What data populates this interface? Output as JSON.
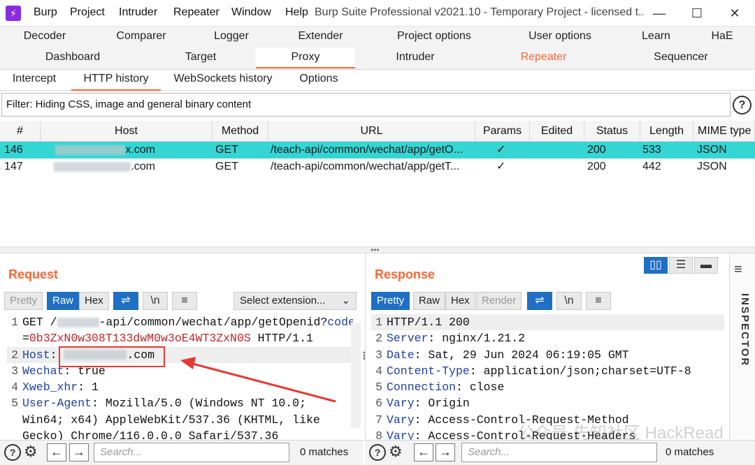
{
  "app": {
    "menu": [
      "Burp",
      "Project",
      "Intruder",
      "Repeater",
      "Window",
      "Help"
    ],
    "window_title": "Burp Suite Professional v2021.10 - Temporary Project - licensed t..."
  },
  "tool_tabs_row1": [
    "Decoder",
    "Comparer",
    "Logger",
    "Extender",
    "Project options",
    "User options",
    "Learn",
    "HaE"
  ],
  "tool_tabs_row2": [
    "Dashboard",
    "Target",
    "Proxy",
    "Intruder",
    "Repeater",
    "Sequencer"
  ],
  "selected_tool_tab": "Proxy",
  "proxy_tabs": [
    "Intercept",
    "HTTP history",
    "WebSockets history",
    "Options"
  ],
  "selected_proxy_tab": "HTTP history",
  "filter": {
    "text": "Filter: Hiding CSS, image and general binary content"
  },
  "history": {
    "columns": [
      "#",
      "Host",
      "Method",
      "URL",
      "Params",
      "Edited",
      "Status",
      "Length",
      "MIME type"
    ],
    "rows": [
      {
        "num": "146",
        "host": "x.com",
        "method": "GET",
        "url": "/teach-api/common/wechat/app/getO...",
        "params": "✓",
        "edited": "",
        "status": "200",
        "length": "533",
        "mime": "JSON",
        "selected": true
      },
      {
        "num": "147",
        "host": ".com",
        "method": "GET",
        "url": "/teach-api/common/wechat/app/getT...",
        "params": "✓",
        "edited": "",
        "status": "200",
        "length": "442",
        "mime": "JSON",
        "selected": false
      }
    ]
  },
  "request": {
    "title": "Request",
    "view_buttons": [
      "Pretty",
      "Raw",
      "Hex"
    ],
    "selected_view": "Raw",
    "extension_select": "Select extension...",
    "lines": [
      {
        "n": "1",
        "parts": [
          {
            "t": "GET /",
            "c": "hv"
          },
          {
            "t": "",
            "blur": 60
          },
          {
            "t": "-api/common/wechat/app/getOpenid?",
            "c": "hv"
          },
          {
            "t": "code",
            "c": "blue"
          }
        ]
      },
      {
        "n": "",
        "parts": [
          {
            "t": "=",
            "c": "hv"
          },
          {
            "t": "0b3ZxN0w308T133dwM0w3oE4WT3ZxN0S",
            "c": "red"
          },
          {
            "t": " HTTP/1.1",
            "c": "hv"
          }
        ]
      },
      {
        "n": "2",
        "parts": [
          {
            "t": "Host",
            "c": "blue"
          },
          {
            "t": ": ",
            "c": "hv"
          },
          {
            "t": "",
            "blur": 90
          },
          {
            "t": ".com",
            "c": "hv"
          }
        ],
        "hl": true
      },
      {
        "n": "3",
        "parts": [
          {
            "t": "Wechat",
            "c": "blue"
          },
          {
            "t": ": true",
            "c": "hv"
          }
        ]
      },
      {
        "n": "4",
        "parts": [
          {
            "t": "Xweb_xhr",
            "c": "blue"
          },
          {
            "t": ": 1",
            "c": "hv"
          }
        ]
      },
      {
        "n": "5",
        "parts": [
          {
            "t": "User-Agent",
            "c": "blue"
          },
          {
            "t": ": Mozilla/5.0 (Windows NT 10.0;",
            "c": "hv"
          }
        ]
      },
      {
        "n": "",
        "parts": [
          {
            "t": "Win64; x64) AppleWebKit/537.36 (KHTML, like",
            "c": "hv"
          }
        ]
      },
      {
        "n": "",
        "parts": [
          {
            "t": "Gecko) Chrome/116.0.0.0 Safari/537.36",
            "c": "hv"
          }
        ]
      }
    ],
    "search_placeholder": "Search...",
    "matches": "0 matches"
  },
  "response": {
    "title": "Response",
    "view_buttons": [
      "Pretty",
      "Raw",
      "Hex",
      "Render"
    ],
    "selected_view": "Pretty",
    "lines": [
      {
        "n": "1",
        "parts": [
          {
            "t": "HTTP/1.1 200",
            "c": "hv"
          }
        ],
        "hl": true
      },
      {
        "n": "2",
        "parts": [
          {
            "t": "Server",
            "c": "blue"
          },
          {
            "t": ": nginx/1.21.2",
            "c": "hv"
          }
        ]
      },
      {
        "n": "3",
        "parts": [
          {
            "t": "Date",
            "c": "blue"
          },
          {
            "t": ": Sat, 29 Jun 2024 06:19:05 GMT",
            "c": "hv"
          }
        ]
      },
      {
        "n": "4",
        "parts": [
          {
            "t": "Content-Type",
            "c": "blue"
          },
          {
            "t": ": application/json;charset=UTF-8",
            "c": "hv"
          }
        ]
      },
      {
        "n": "5",
        "parts": [
          {
            "t": "Connection",
            "c": "blue"
          },
          {
            "t": ": close",
            "c": "hv"
          }
        ]
      },
      {
        "n": "6",
        "parts": [
          {
            "t": "Vary",
            "c": "blue"
          },
          {
            "t": ": Origin",
            "c": "hv"
          }
        ]
      },
      {
        "n": "7",
        "parts": [
          {
            "t": "Vary",
            "c": "blue"
          },
          {
            "t": ": Access-Control-Request-Method",
            "c": "hv"
          }
        ]
      },
      {
        "n": "8",
        "parts": [
          {
            "t": "Vary",
            "c": "blue"
          },
          {
            "t": ": Access-Control-Request-Headers",
            "c": "hv"
          }
        ]
      }
    ],
    "search_placeholder": "Search...",
    "matches": "0 matches"
  },
  "inspector": {
    "label": "INSPECTOR"
  },
  "watermark": "公众号·先知社区 HackRead",
  "colors": {
    "accent": "#ff6633",
    "selected_row": "#35d5d4",
    "button_active": "#1f6fc4",
    "annotation_red": "#e53935"
  }
}
